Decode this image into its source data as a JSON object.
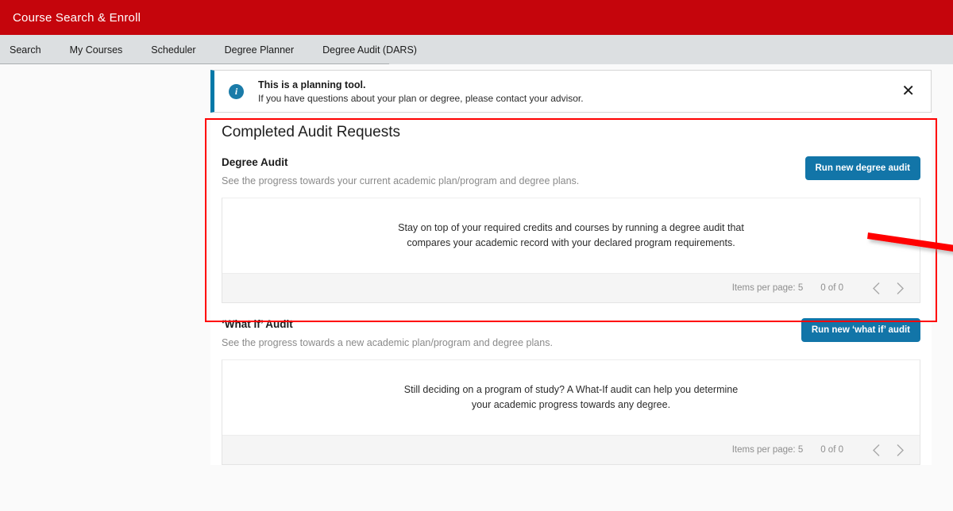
{
  "header": {
    "app_title": "Course Search & Enroll",
    "brand_color": "#c5050c"
  },
  "nav": {
    "tabs": [
      {
        "label": "Search"
      },
      {
        "label": "My Courses"
      },
      {
        "label": "Scheduler"
      },
      {
        "label": "Degree Planner"
      },
      {
        "label": "Degree Audit (DARS)"
      }
    ]
  },
  "banner": {
    "icon": "info-icon",
    "title": "This is a planning tool.",
    "subtitle": "If you have questions about your plan or degree, please contact your advisor.",
    "close_label": "✕",
    "accent_color": "#0479a8"
  },
  "main": {
    "card_title": "Completed Audit Requests",
    "sections": [
      {
        "heading": "Degree Audit",
        "description": "See the progress towards your current academic plan/program and degree plans.",
        "button_label": "Run new degree audit",
        "empty_line1": "Stay on top of your required credits and courses by running a degree audit that",
        "empty_line2": "compares your academic record with your declared program requirements.",
        "paginator": {
          "items_per_page_label": "Items per page: 5",
          "range_label": "0 of 0",
          "prev_icon": "chevron-left-icon",
          "next_icon": "chevron-right-icon"
        }
      },
      {
        "heading": "‘What if’ Audit",
        "description": "See the progress towards a new academic plan/program and degree plans.",
        "button_label": "Run new ‘what if’ audit",
        "empty_line1": "Still deciding on a program of study? A What-If audit can help you determine",
        "empty_line2": "your academic progress towards any degree.",
        "paginator": {
          "items_per_page_label": "Items per page: 5",
          "range_label": "0 of 0",
          "prev_icon": "chevron-left-icon",
          "next_icon": "chevron-right-icon"
        }
      }
    ]
  },
  "annotations": {
    "highlight_color": "#ff0000",
    "arrow_color": "#ff0000",
    "button_color": "#1275a8"
  }
}
